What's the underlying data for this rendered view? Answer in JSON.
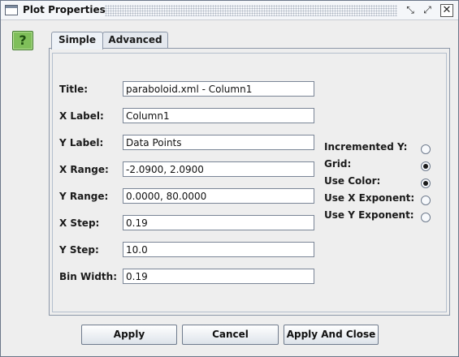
{
  "window": {
    "title": "Plot Properties",
    "controls": {
      "restore_glyph": "⤡",
      "maximize_glyph": "⤢",
      "close_glyph": "✕"
    }
  },
  "help": {
    "glyph": "?"
  },
  "tabs": [
    {
      "label": "Simple",
      "active": true
    },
    {
      "label": "Advanced",
      "active": false
    }
  ],
  "form": {
    "title": {
      "label": "Title:",
      "value": "paraboloid.xml - Column1"
    },
    "x_label": {
      "label": "X Label:",
      "value": "Column1"
    },
    "y_label": {
      "label": "Y Label:",
      "value": "Data Points"
    },
    "x_range": {
      "label": "X Range:",
      "value": "-2.0900, 2.0900"
    },
    "y_range": {
      "label": "Y Range:",
      "value": "0.0000, 80.0000"
    },
    "x_step": {
      "label": "X Step:",
      "value": "0.19"
    },
    "y_step": {
      "label": "Y Step:",
      "value": "10.0"
    },
    "bin_width": {
      "label": "Bin Width:",
      "value": "0.19"
    }
  },
  "options": [
    {
      "label": "Incremented Y:",
      "checked": false
    },
    {
      "label": "Grid:",
      "checked": true
    },
    {
      "label": "Use Color:",
      "checked": true
    },
    {
      "label": "Use X Exponent:",
      "checked": false
    },
    {
      "label": "Use Y Exponent:",
      "checked": false
    }
  ],
  "buttons": {
    "apply": "Apply",
    "cancel": "Cancel",
    "apply_and_close": "Apply And Close"
  }
}
